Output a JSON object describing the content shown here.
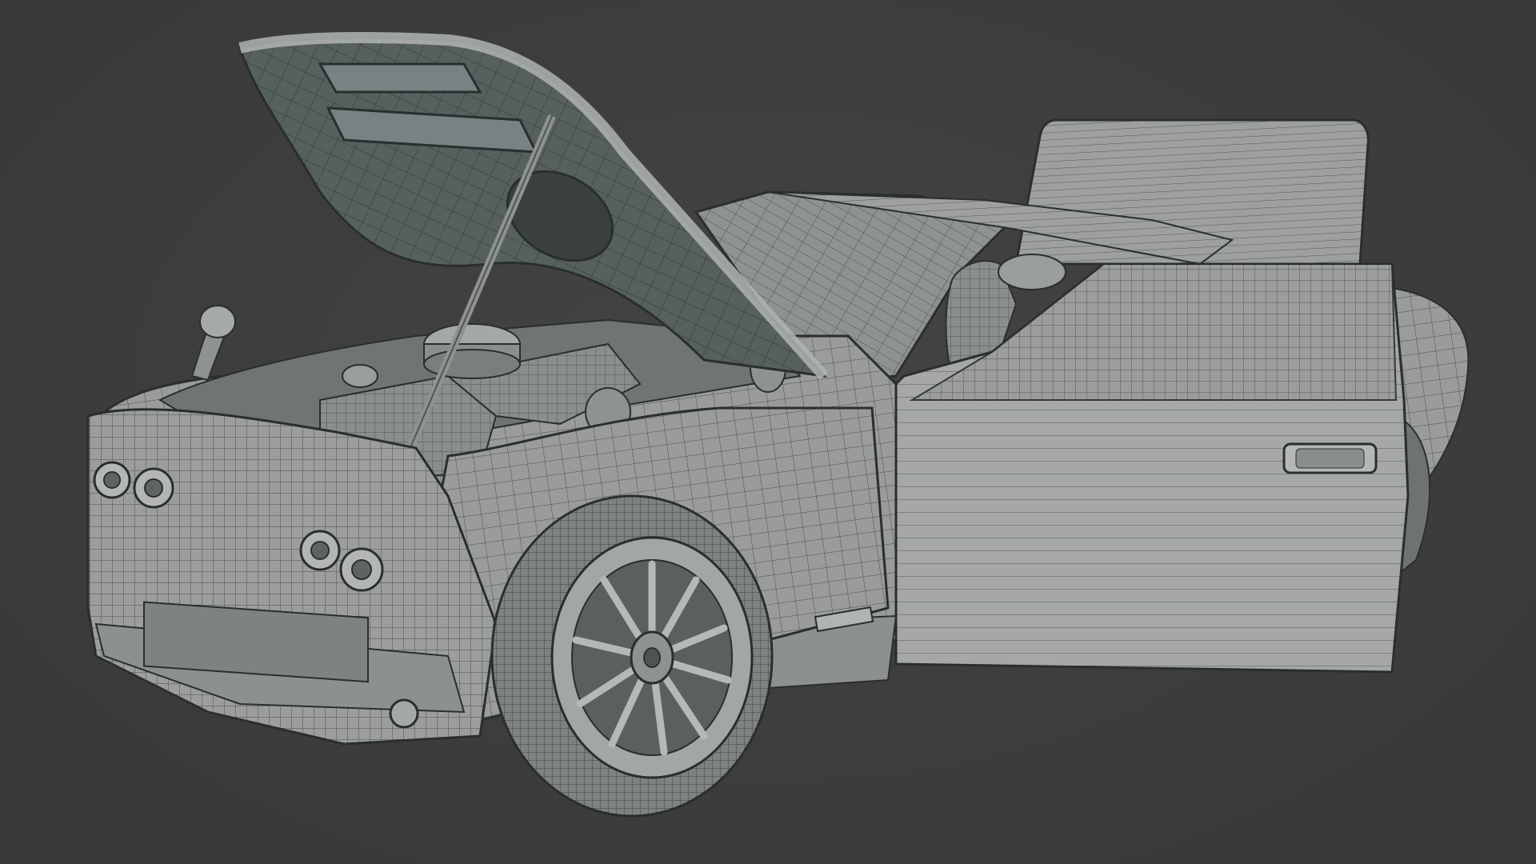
{
  "viewport": {
    "background_color": "#3d3d3d",
    "subject": "car-wireframe-model"
  },
  "model": {
    "colors": {
      "body": "#9a9c9c",
      "body_light": "#b4b6b6",
      "body_dark": "#6e7272",
      "hood_inner": "#4f5a5a",
      "wire": "#2a2e2e",
      "tire": "#7c8080",
      "rim": "#a6a8a8"
    },
    "parts": [
      "hood-open",
      "hood-strut",
      "front-bumper",
      "headlights",
      "front-wheel",
      "fender",
      "door-open",
      "trunk-lid",
      "engine-bay",
      "side-mirror",
      "windshield"
    ]
  }
}
